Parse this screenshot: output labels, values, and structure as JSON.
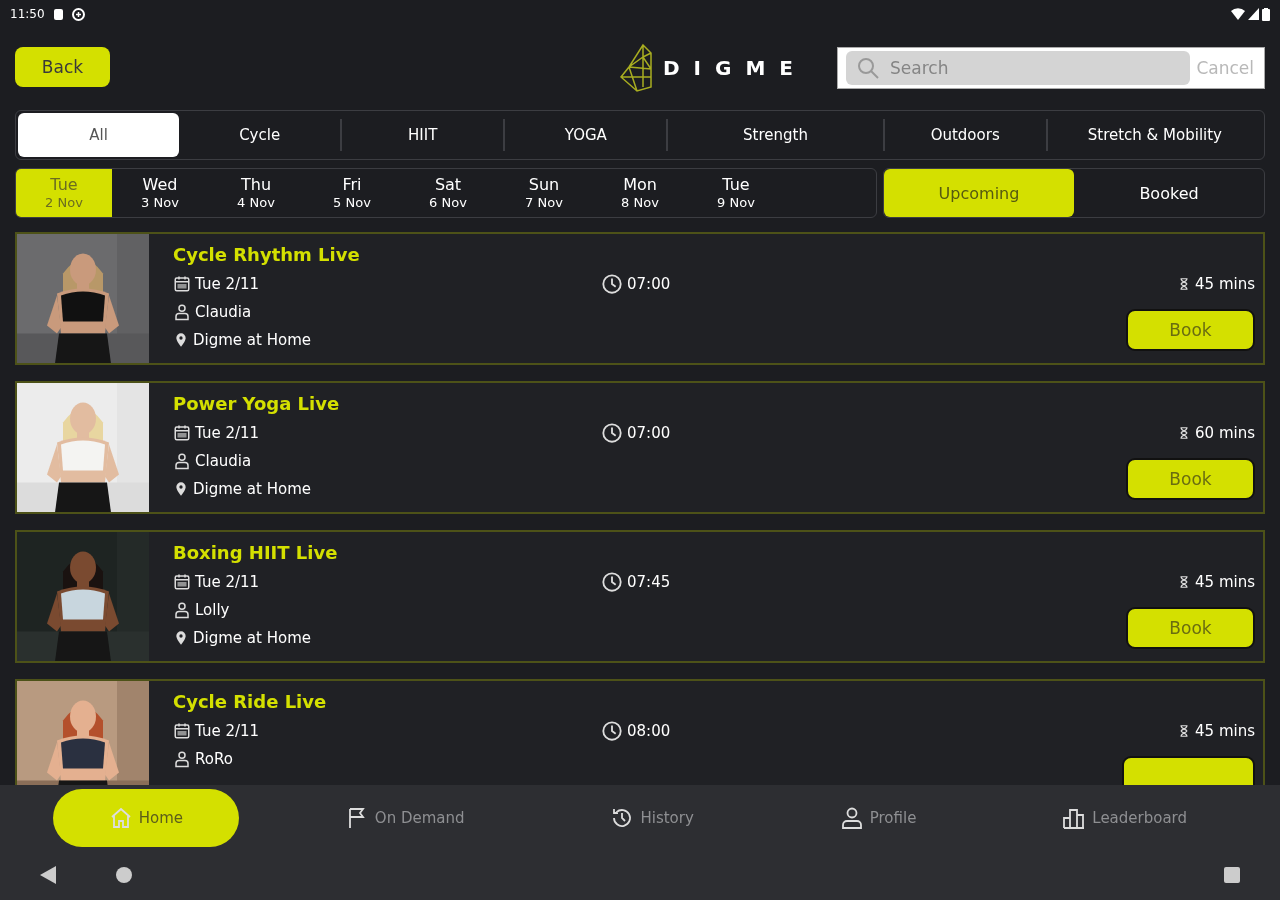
{
  "status_bar": {
    "time": "11:50"
  },
  "header": {
    "back_button": "Back",
    "logo_text": "DIGME",
    "search": {
      "placeholder": "Search"
    },
    "cancel_button": "Cancel"
  },
  "categories": [
    {
      "label": "All",
      "selected": true
    },
    {
      "label": "Cycle",
      "selected": false
    },
    {
      "label": "HIIT",
      "selected": false
    },
    {
      "label": "YOGA",
      "selected": false
    },
    {
      "label": "Strength",
      "selected": false
    },
    {
      "label": "Outdoors",
      "selected": false
    },
    {
      "label": "Stretch & Mobility",
      "selected": false
    }
  ],
  "dates": [
    {
      "day": "Tue",
      "date": "2 Nov",
      "selected": true
    },
    {
      "day": "Wed",
      "date": "3 Nov",
      "selected": false
    },
    {
      "day": "Thu",
      "date": "4 Nov",
      "selected": false
    },
    {
      "day": "Fri",
      "date": "5 Nov",
      "selected": false
    },
    {
      "day": "Sat",
      "date": "6 Nov",
      "selected": false
    },
    {
      "day": "Sun",
      "date": "7 Nov",
      "selected": false
    },
    {
      "day": "Mon",
      "date": "8 Nov",
      "selected": false
    },
    {
      "day": "Tue",
      "date": "9 Nov",
      "selected": false
    }
  ],
  "filters": [
    {
      "label": "Upcoming",
      "selected": true
    },
    {
      "label": "Booked",
      "selected": false
    }
  ],
  "classes": [
    {
      "title": "Cycle Rhythm Live",
      "date": "Tue 2/11",
      "instructor": "Claudia",
      "location": "Digme at Home",
      "time": "07:00",
      "duration": "45 mins",
      "button": "Book"
    },
    {
      "title": "Power Yoga Live",
      "date": "Tue 2/11",
      "instructor": "Claudia",
      "location": "Digme at Home",
      "time": "07:00",
      "duration": "60 mins",
      "button": "Book"
    },
    {
      "title": "Boxing HIIT Live",
      "date": "Tue 2/11",
      "instructor": "Lolly",
      "location": "Digme at Home",
      "time": "07:45",
      "duration": "45 mins",
      "button": "Book"
    },
    {
      "title": "Cycle Ride Live",
      "date": "Tue 2/11",
      "instructor": "RoRo",
      "time": "08:00",
      "duration": "45 mins"
    }
  ],
  "nav": [
    {
      "kind": "home",
      "label": "Home",
      "selected": true
    },
    {
      "kind": "on-demand",
      "label": "On Demand",
      "selected": false
    },
    {
      "kind": "history",
      "label": "History",
      "selected": false
    },
    {
      "kind": "profile",
      "label": "Profile",
      "selected": false
    },
    {
      "kind": "leaderboard",
      "label": "Leaderboard",
      "selected": false
    }
  ]
}
